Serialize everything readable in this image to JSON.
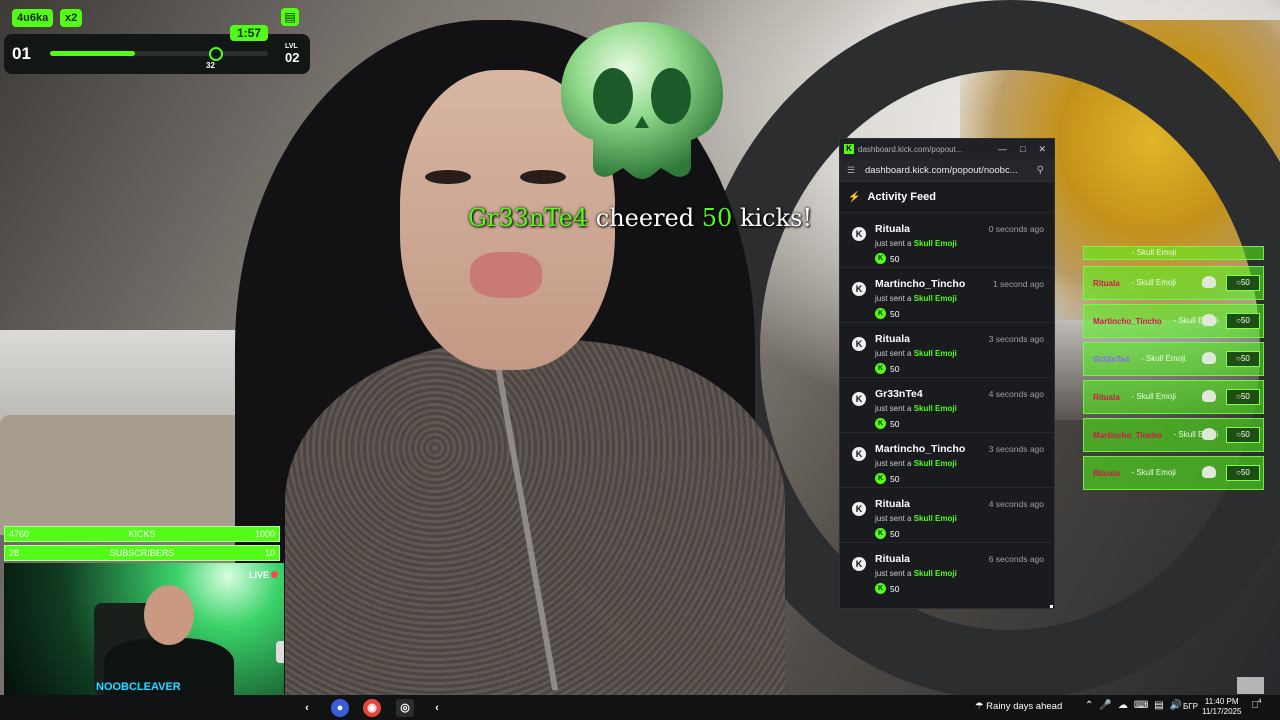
{
  "hud": {
    "user_badge": "4u6ka",
    "multiplier_badge": "x2",
    "timer": "1:57",
    "level_current": "01",
    "progress_value": "32",
    "progress_fraction": 0.39,
    "level_label": "LVL",
    "level_next": "02",
    "bus_icon": "bus-icon"
  },
  "alert": {
    "name": "Gr33nTe4",
    "verb": "cheered",
    "amount": "50",
    "unit": "kicks!"
  },
  "popout": {
    "title": "dashboard.kick.com/popout...",
    "url": "dashboard.kick.com/popout/noobc...",
    "feed_title": "Activity Feed",
    "action_prefix": "just sent a",
    "items": [
      {
        "name": "Rituala",
        "time": "0 seconds ago",
        "item": "Skull Emoji",
        "amount": "50"
      },
      {
        "name": "Martincho_Tincho",
        "time": "1 second ago",
        "item": "Skull Emoji",
        "amount": "50"
      },
      {
        "name": "Rituala",
        "time": "3 seconds ago",
        "item": "Skull Emoji",
        "amount": "50"
      },
      {
        "name": "Gr33nTe4",
        "time": "4 seconds ago",
        "item": "Skull Emoji",
        "amount": "50"
      },
      {
        "name": "Martincho_Tincho",
        "time": "3 seconds ago",
        "item": "Skull Emoji",
        "amount": "50"
      },
      {
        "name": "Rituala",
        "time": "4 seconds ago",
        "item": "Skull Emoji",
        "amount": "50"
      },
      {
        "name": "Rituala",
        "time": "6 seconds ago",
        "item": "Skull Emoji",
        "amount": "50"
      }
    ]
  },
  "alerts_stack": [
    {
      "name": "Rituala",
      "item": "- Skull Emoji",
      "value": "50"
    },
    {
      "name": "Martincho_Tincho",
      "item": "- Skull Emoji",
      "value": "50"
    },
    {
      "name": "Gr33nTe4",
      "item": "- Skull Emoji",
      "value": "50"
    },
    {
      "name": "Rituala",
      "item": "- Skull Emoji",
      "value": "50"
    },
    {
      "name": "Martincho_Tincho",
      "item": "- Skull Emoji",
      "value": "50"
    },
    {
      "name": "Rituala",
      "item": "- Skull Emoji",
      "value": "50"
    }
  ],
  "goals": {
    "kicks": {
      "current": "4760",
      "label": "KICKS",
      "target": "1000"
    },
    "subs": {
      "current": "28",
      "label": "SUBSCRIBERS",
      "target": "10"
    }
  },
  "webcam": {
    "live_label": "LIVE",
    "username": "NOOBCLEAVER"
  },
  "taskbar": {
    "weather": "Rainy days ahead",
    "lang": "БГР",
    "time": "11:40 PM",
    "date": "11/17/2025",
    "notify_count": "4"
  },
  "colors": {
    "kick_green": "#53fc18",
    "panel_dark": "#191b1f",
    "alert_name_red": "#d5154b"
  }
}
